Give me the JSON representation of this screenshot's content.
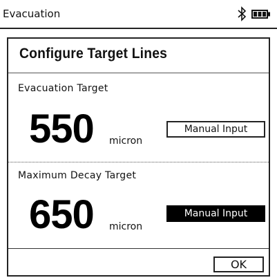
{
  "status_bar": {
    "title": "Evacuation",
    "bluetooth_icon": "bluetooth-icon",
    "battery_icon": "battery-icon"
  },
  "dialog": {
    "title": "Configure Target Lines",
    "evacuation_target": {
      "label": "Evacuation Target",
      "value": "550",
      "unit": "micron",
      "button_label": "Manual Input",
      "selected": false
    },
    "max_decay_target": {
      "label": "Maximum Decay Target",
      "value": "650",
      "unit": "micron",
      "button_label": "Manual Input",
      "selected": true
    },
    "ok_label": "OK"
  },
  "colors": {
    "foreground": "#111111",
    "background": "#ffffff",
    "selected_bg": "#000000",
    "selected_fg": "#ffffff"
  }
}
